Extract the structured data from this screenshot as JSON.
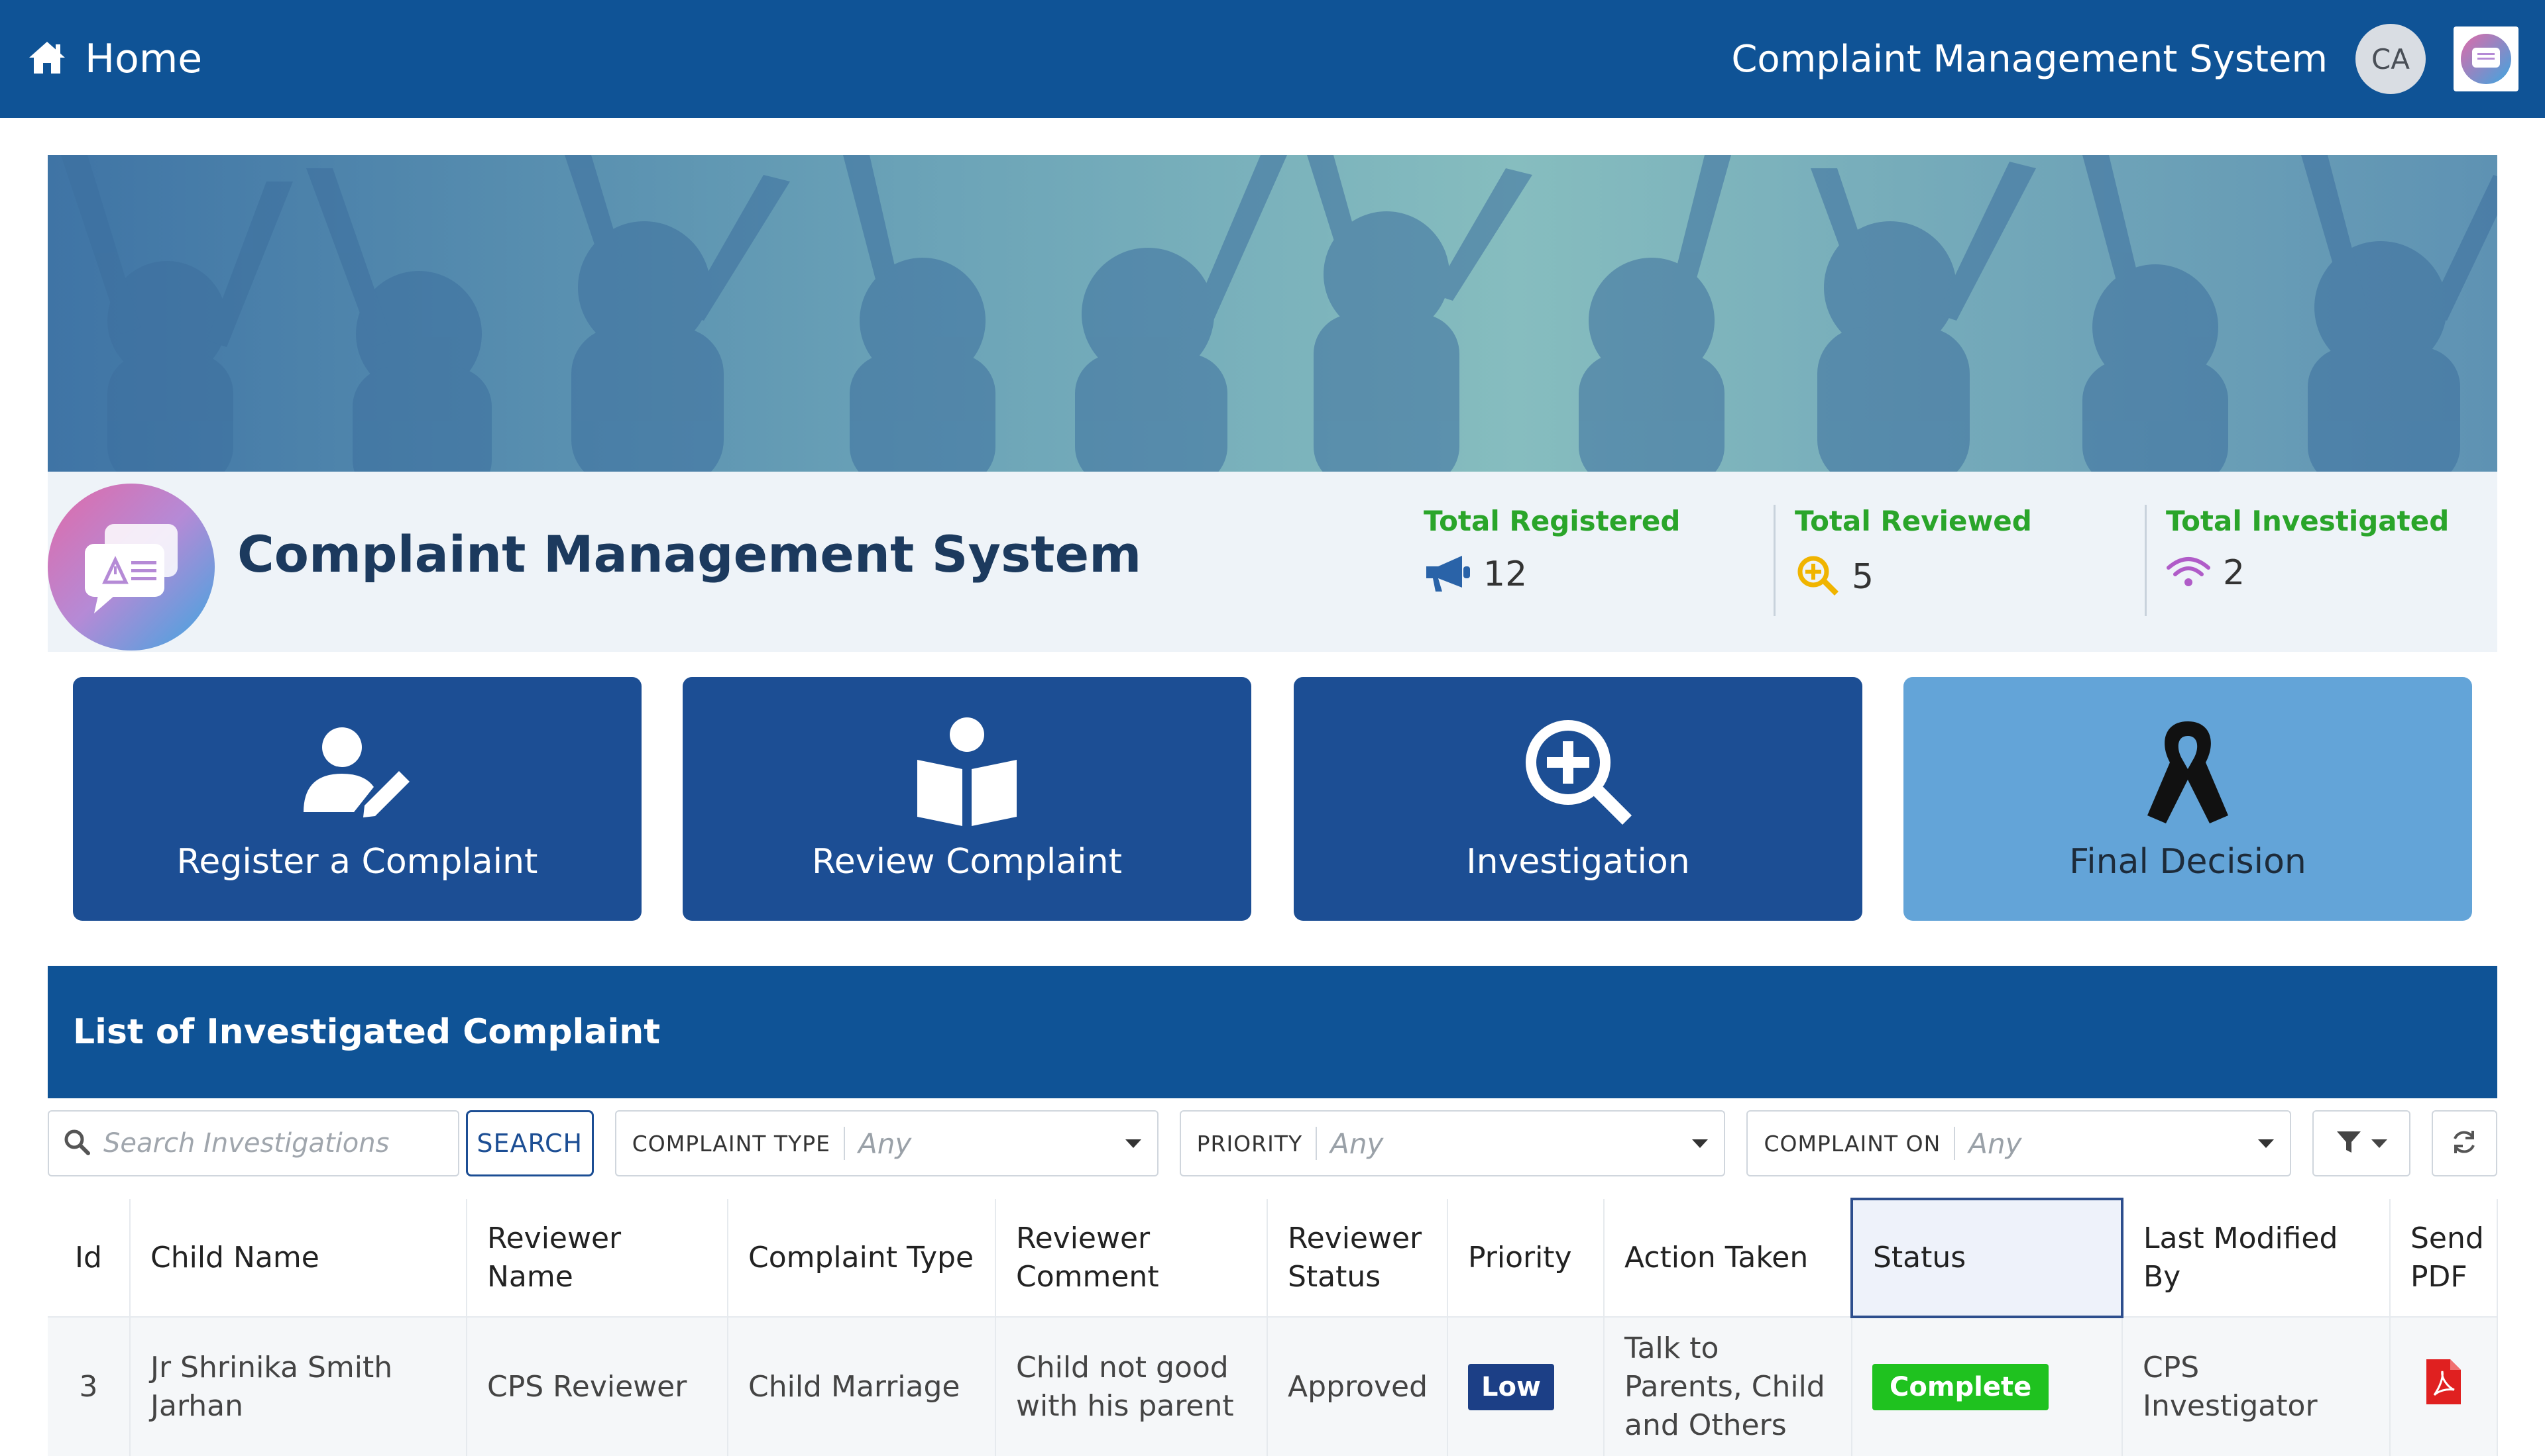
{
  "topbar": {
    "home_label": "Home",
    "app_title": "Complaint Management System",
    "user_initials": "CA"
  },
  "banner": {
    "title": "Complaint Management System",
    "stats": [
      {
        "label": "Total Registered",
        "value": "12",
        "icon": "megaphone-icon"
      },
      {
        "label": "Total Reviewed",
        "value": "5",
        "icon": "search-plus-icon"
      },
      {
        "label": "Total Investigated",
        "value": "2",
        "icon": "wifi-icon"
      }
    ]
  },
  "tiles": [
    {
      "label": "Register a Complaint",
      "icon": "user-edit-icon"
    },
    {
      "label": "Review Complaint",
      "icon": "reader-icon"
    },
    {
      "label": "Investigation",
      "icon": "search-plus-icon"
    },
    {
      "label": "Final Decision",
      "icon": "ribbon-icon"
    }
  ],
  "list": {
    "title": "List of Investigated Complaint",
    "search_placeholder": "Search Investigations",
    "search_button": "SEARCH",
    "filters": [
      {
        "label": "COMPLAINT TYPE",
        "value": "Any"
      },
      {
        "label": "PRIORITY",
        "value": "Any"
      },
      {
        "label": "COMPLAINT ON",
        "value": "Any"
      }
    ],
    "columns": [
      "Id",
      "Child Name",
      "Reviewer Name",
      "Complaint Type",
      "Reviewer Comment",
      "Reviewer Status",
      "Priority",
      "Action Taken",
      "Status",
      "Last Modified By",
      "Send PDF"
    ],
    "rows": [
      {
        "id": "3",
        "child_name": "Jr Shrinika Smith Jarhan",
        "reviewer_name": "CPS Reviewer",
        "complaint_type": "Child Marriage",
        "reviewer_comment": "Child not  good with his parent",
        "reviewer_status": "Approved",
        "priority": "Low",
        "action_taken": "Talk to Parents, Child and Others",
        "status": "Complete",
        "last_modified_by": "CPS Investigator"
      }
    ]
  },
  "colors": {
    "primary": "#0f5396",
    "tile": "#1c4e94",
    "tile_light": "#63a4d8",
    "stat_label": "#2aa52a",
    "badge_low": "#1c3f86",
    "badge_complete": "#1fc21f",
    "pdf": "#e02020"
  }
}
